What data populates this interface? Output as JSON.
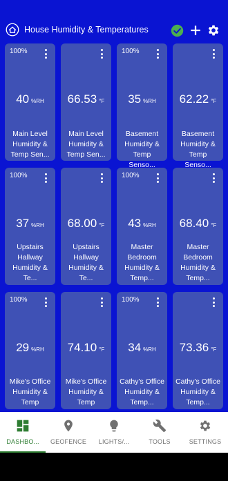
{
  "header": {
    "title": "House Humidity & Temperatures"
  },
  "tiles": [
    {
      "pct": "100%",
      "value": "40",
      "unit": "%RH",
      "label": "Main Level Humidity & Temp Sen..."
    },
    {
      "pct": "",
      "value": "66.53",
      "unit": "°F",
      "label": "Main Level Humidity & Temp Sen..."
    },
    {
      "pct": "100%",
      "value": "35",
      "unit": "%RH",
      "label": "Basement Humidity & Temp Senso..."
    },
    {
      "pct": "",
      "value": "62.22",
      "unit": "°F",
      "label": "Basement Humidity & Temp Senso..."
    },
    {
      "pct": "100%",
      "value": "37",
      "unit": "%RH",
      "label": "Upstairs Hallway Humidity & Te..."
    },
    {
      "pct": "",
      "value": "68.00",
      "unit": "°F",
      "label": "Upstairs Hallway Humidity & Te..."
    },
    {
      "pct": "100%",
      "value": "43",
      "unit": "%RH",
      "label": "Master Bedroom Humidity & Temp..."
    },
    {
      "pct": "",
      "value": "68.40",
      "unit": "°F",
      "label": "Master Bedroom Humidity & Temp..."
    },
    {
      "pct": "100%",
      "value": "29",
      "unit": "%RH",
      "label": "Mike's Office Humidity & Temp"
    },
    {
      "pct": "",
      "value": "74.10",
      "unit": "°F",
      "label": "Mike's Office Humidity & Temp"
    },
    {
      "pct": "100%",
      "value": "34",
      "unit": "%RH",
      "label": "Cathy's Office Humidity & Temp..."
    },
    {
      "pct": "",
      "value": "73.36",
      "unit": "°F",
      "label": "Cathy's Office Humidity & Temp..."
    }
  ],
  "nav": [
    {
      "label": "DASHBO...",
      "icon": "dashboard-icon",
      "active": true
    },
    {
      "label": "GEOFENCE",
      "icon": "location-pin-icon",
      "active": false
    },
    {
      "label": "LIGHTS/...",
      "icon": "lightbulb-icon",
      "active": false
    },
    {
      "label": "TOOLS",
      "icon": "wrench-icon",
      "active": false
    },
    {
      "label": "SETTINGS",
      "icon": "gear-icon",
      "active": false
    }
  ],
  "colors": {
    "background": "#0a14d2",
    "tile": "#3f51b5",
    "accent": "#2e7d32",
    "check": "#4caf50"
  }
}
